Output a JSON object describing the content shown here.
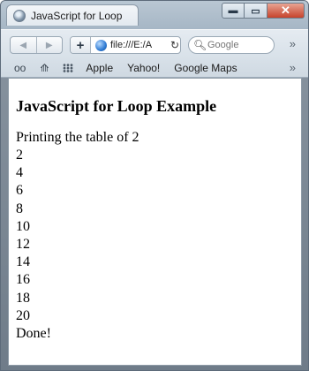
{
  "window": {
    "tab_title": "JavaScript for Loop",
    "controls": {
      "minimize": "▬",
      "maximize": "▭",
      "close": "✕"
    }
  },
  "toolbar": {
    "back_icon": "◀",
    "forward_icon": "▶",
    "new_tab_icon": "+",
    "url": "file:///E:/A",
    "reload_icon": "↻",
    "search_placeholder": "Google",
    "overflow_icon": "»"
  },
  "bookmarks": {
    "items": [
      "Apple",
      "Yahoo!",
      "Google Maps"
    ],
    "reading_list_icon": "👓",
    "bookmarks_icon": "📖",
    "overflow_icon": "»"
  },
  "page": {
    "heading": "JavaScript for Loop Example",
    "intro": "Printing the table of 2",
    "numbers": [
      "2",
      "4",
      "6",
      "8",
      "10",
      "12",
      "14",
      "16",
      "18",
      "20"
    ],
    "done": "Done!"
  }
}
